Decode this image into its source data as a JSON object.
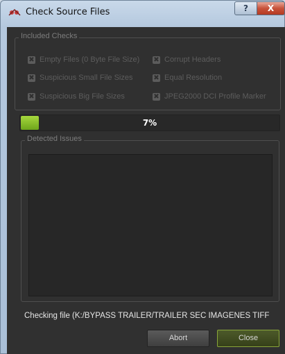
{
  "window": {
    "title": "Check Source Files",
    "help_label": "?",
    "close_label": "X"
  },
  "included_checks": {
    "title": "Included Checks",
    "items": [
      {
        "label": "Empty Files (0 Byte File Size)",
        "checked": true
      },
      {
        "label": "Corrupt Headers",
        "checked": true
      },
      {
        "label": "Suspicious Small File Sizes",
        "checked": true
      },
      {
        "label": "Equal Resolution",
        "checked": true
      },
      {
        "label": "Suspicious Big File Sizes",
        "checked": true
      },
      {
        "label": "JPEG2000 DCI Profile Marker",
        "checked": true
      }
    ]
  },
  "progress": {
    "percent_label": "7%",
    "value": 0.07,
    "fill_color": "#8cc22c"
  },
  "detected_issues": {
    "title": "Detected Issues"
  },
  "status_text": "Checking file (K:/BYPASS TRAILER/TRAILER SEC IMAGENES TIFF",
  "buttons": {
    "abort_label": "Abort",
    "close_label": "Close"
  }
}
